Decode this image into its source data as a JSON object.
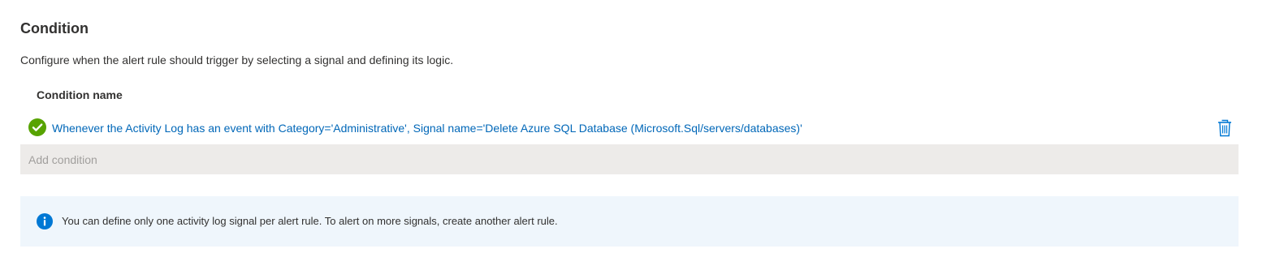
{
  "section": {
    "title": "Condition",
    "description": "Configure when the alert rule should trigger by selecting a signal and defining its logic."
  },
  "table": {
    "column_header": "Condition name",
    "rows": [
      {
        "status_icon": "checkmark-circle-icon",
        "status_color": "#57a300",
        "text": "Whenever the Activity Log has an event with Category='Administrative', Signal name='Delete Azure SQL Database (Microsoft.Sql/servers/databases)'",
        "delete_icon": "trash-icon"
      }
    ],
    "add_condition_label": "Add condition"
  },
  "info_banner": {
    "icon": "info-icon",
    "text": "You can define only one activity log signal per alert rule. To alert on more signals, create another alert rule."
  },
  "colors": {
    "link": "#0067b8",
    "info_background": "#eff6fc",
    "info_icon": "#0078d4",
    "disabled_background": "#edebe9",
    "disabled_text": "#a19f9d"
  }
}
